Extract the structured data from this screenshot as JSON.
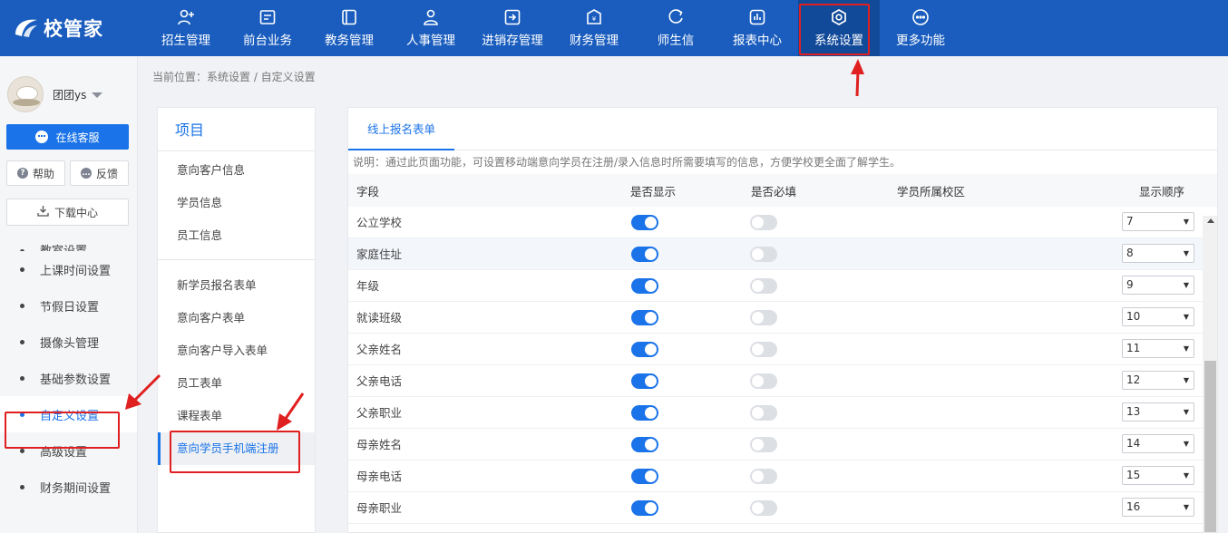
{
  "app": {
    "logo_text": "校管家"
  },
  "nav": [
    {
      "label": "招生管理",
      "icon": "user-plus-icon"
    },
    {
      "label": "前台业务",
      "icon": "desk-icon"
    },
    {
      "label": "教务管理",
      "icon": "book-icon"
    },
    {
      "label": "人事管理",
      "icon": "person-icon"
    },
    {
      "label": "进销存管理",
      "icon": "inventory-icon"
    },
    {
      "label": "财务管理",
      "icon": "finance-icon"
    },
    {
      "label": "师生信",
      "icon": "message-icon"
    },
    {
      "label": "报表中心",
      "icon": "report-icon"
    },
    {
      "label": "系统设置",
      "icon": "settings-icon"
    },
    {
      "label": "更多功能",
      "icon": "more-icon"
    }
  ],
  "sidebar": {
    "user_name": "团团ys",
    "service_label": "在线客服",
    "help_label": "帮助",
    "feedback_label": "反馈",
    "download_label": "下载中心",
    "menu_cut_label": "教室设置",
    "menu": [
      {
        "label": "上课时间设置"
      },
      {
        "label": "节假日设置"
      },
      {
        "label": "摄像头管理"
      },
      {
        "label": "基础参数设置"
      },
      {
        "label": "自定义设置"
      },
      {
        "label": "高级设置"
      },
      {
        "label": "财务期间设置"
      }
    ]
  },
  "breadcrumb": "当前位置：系统设置 / 自定义设置",
  "items_panel": {
    "title": "项目",
    "group1": [
      "意向客户信息",
      "学员信息",
      "员工信息"
    ],
    "group2": [
      "新学员报名表单",
      "意向客户表单",
      "意向客户导入表单",
      "员工表单",
      "课程表单",
      "意向学员手机端注册"
    ]
  },
  "main": {
    "tab_label": "线上报名表单",
    "description": "说明：通过此页面功能，可设置移动端意向学员在注册/录入信息时所需要填写的信息，方便学校更全面了解学生。",
    "headers": {
      "field": "字段",
      "show": "是否显示",
      "required": "是否必填",
      "campus": "学员所属校区",
      "order": "显示顺序"
    },
    "rows": [
      {
        "field": "公立学校",
        "show": true,
        "required": false,
        "order": "7"
      },
      {
        "field": "家庭住址",
        "show": true,
        "required": false,
        "order": "8"
      },
      {
        "field": "年级",
        "show": true,
        "required": false,
        "order": "9"
      },
      {
        "field": "就读班级",
        "show": true,
        "required": false,
        "order": "10"
      },
      {
        "field": "父亲姓名",
        "show": true,
        "required": false,
        "order": "11"
      },
      {
        "field": "父亲电话",
        "show": true,
        "required": false,
        "order": "12"
      },
      {
        "field": "父亲职业",
        "show": true,
        "required": false,
        "order": "13"
      },
      {
        "field": "母亲姓名",
        "show": true,
        "required": false,
        "order": "14"
      },
      {
        "field": "母亲电话",
        "show": true,
        "required": false,
        "order": "15"
      },
      {
        "field": "母亲职业",
        "show": true,
        "required": false,
        "order": "16"
      }
    ]
  },
  "colors": {
    "topbar": "#1a5dbe",
    "accent": "#1a73e8",
    "annotation": "#e02020"
  }
}
